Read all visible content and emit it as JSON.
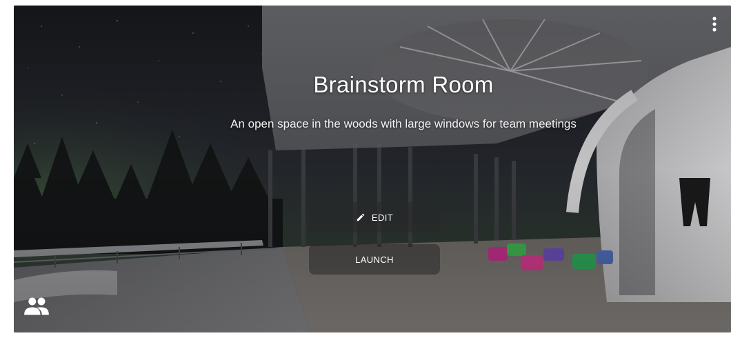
{
  "card": {
    "title": "Brainstorm Room",
    "description": "An open space in the woods with large windows for team meetings"
  },
  "actions": {
    "edit_label": "EDIT",
    "launch_label": "LAUNCH"
  },
  "icons": {
    "menu": "more-vert-icon",
    "edit": "pencil-icon",
    "participants": "people-icon"
  },
  "colors": {
    "text": "#ffffff",
    "button_bg": "rgba(40,40,40,0.55)"
  }
}
